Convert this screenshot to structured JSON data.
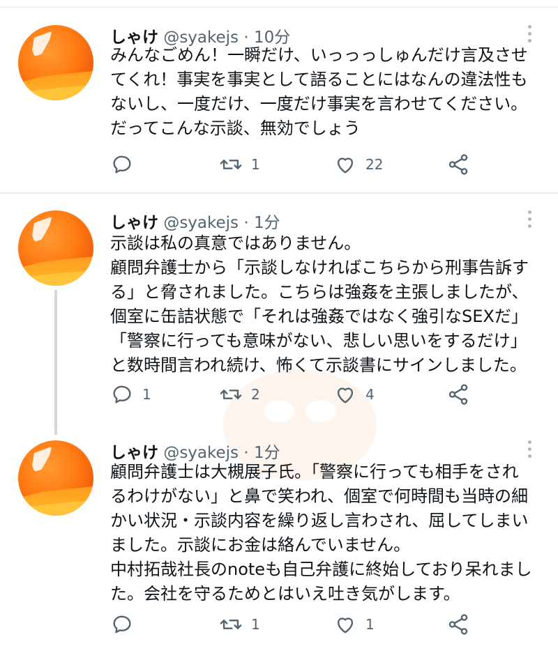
{
  "tweets": [
    {
      "name": "しゃけ",
      "handle": "@syakejs",
      "sep": "·",
      "time": "10分",
      "lines": [
        "みんなごめん！一瞬だけ、いっっっしゅんだけ言及させ",
        "てくれ！事実を事実として語ることにはなんの違法性も",
        "ないし、一度だけ、一度だけ事実を言わせてください。",
        "だってこんな示談、無効でしょう"
      ],
      "reply_count": "",
      "retweet_count": "1",
      "like_count": "22"
    },
    {
      "name": "しゃけ",
      "handle": "@syakejs",
      "sep": "·",
      "time": "1分",
      "lines": [
        "示談は私の真意ではありません。",
        "顧問弁護士から「示談しなければこちらから刑事告訴す",
        "る」と脅されました。こちらは強姦を主張しましたが、",
        "個室に缶詰状態で「それは強姦ではなく強引なSEXだ」",
        "「警察に行っても意味がない、悲しい思いをするだけ」",
        "と数時間言われ続け、怖くて示談書にサインしました。"
      ],
      "reply_count": "1",
      "retweet_count": "2",
      "like_count": "4"
    },
    {
      "name": "しゃけ",
      "handle": "@syakejs",
      "sep": "·",
      "time": "1分",
      "lines": [
        "顧問弁護士は大槻展子氏。「警察に行っても相手をされ",
        "るわけがない」と鼻で笑われ、個室で何時間も当時の細",
        "かい状況・示談内容を繰り返し言わされ、屈してしまい",
        "ました。示談にお金は絡んでいません。",
        "中村拓哉社長のnoteも自己弁護に終始しており呆れまし",
        "た。会社を守るためとはいえ吐き気がします。"
      ],
      "reply_count": "",
      "retweet_count": "1",
      "like_count": "1"
    }
  ],
  "icons": [
    "reply-icon",
    "retweet-icon",
    "like-icon",
    "share-icon",
    "more-icon"
  ],
  "colors": {
    "icon": "#536471",
    "thread_line": "#cfd9de",
    "avatar": "#ff7a12"
  }
}
